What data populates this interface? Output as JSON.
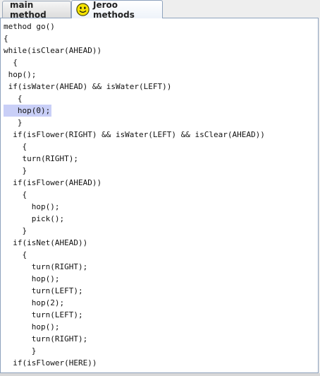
{
  "tabs": [
    {
      "label": "main method",
      "selected": false
    },
    {
      "label": "Jeroo methods",
      "selected": true,
      "icon": "smiley-icon"
    }
  ],
  "colors": {
    "highlight": "#c9cff7",
    "tab_border": "#8ea2bd",
    "smiley": "#f5e300"
  },
  "editor": {
    "highlighted_line_index": 7,
    "lines": [
      "method go()",
      "{",
      "while(isClear(AHEAD))",
      "  {",
      " hop();",
      " if(isWater(AHEAD) && isWater(LEFT))",
      "   {",
      "   hop(0);",
      "   }",
      "  if(isFlower(RIGHT) && isWater(LEFT) && isClear(AHEAD))",
      "    {",
      "    turn(RIGHT);",
      "    }",
      "  if(isFlower(AHEAD))",
      "    {",
      "      hop();",
      "      pick();",
      "    }",
      "  if(isNet(AHEAD))",
      "    {",
      "      turn(RIGHT);",
      "      hop();",
      "      turn(LEFT);",
      "      hop(2);",
      "      turn(LEFT);",
      "      hop();",
      "      turn(RIGHT);",
      "      }",
      "  if(isFlower(HERE))"
    ]
  }
}
